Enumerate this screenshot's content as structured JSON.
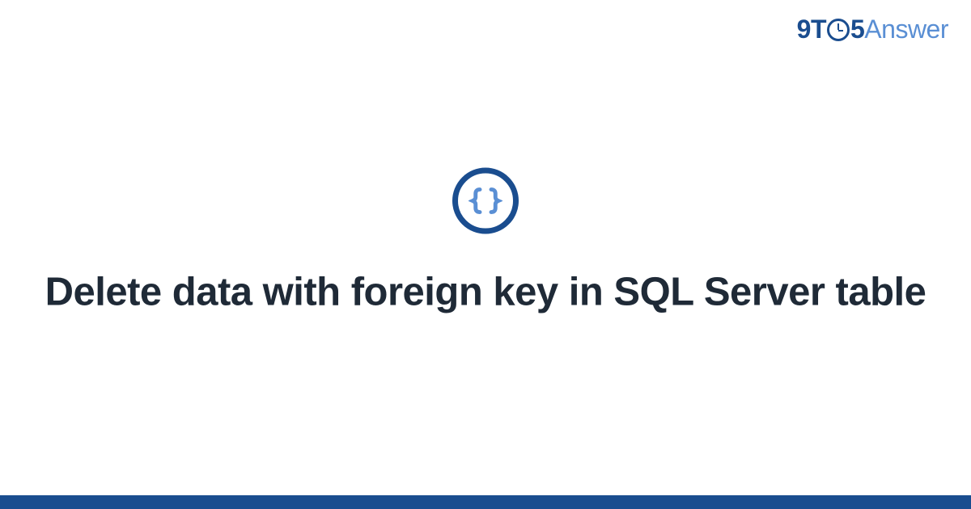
{
  "logo": {
    "part1": "9T",
    "part2": "5",
    "part3": "Answer"
  },
  "icon": {
    "name": "code-braces-icon"
  },
  "main": {
    "title": "Delete data with foreign key in SQL Server table"
  },
  "colors": {
    "primary": "#1a4d8f",
    "accent": "#5a8fd4",
    "text": "#1f2a37"
  }
}
